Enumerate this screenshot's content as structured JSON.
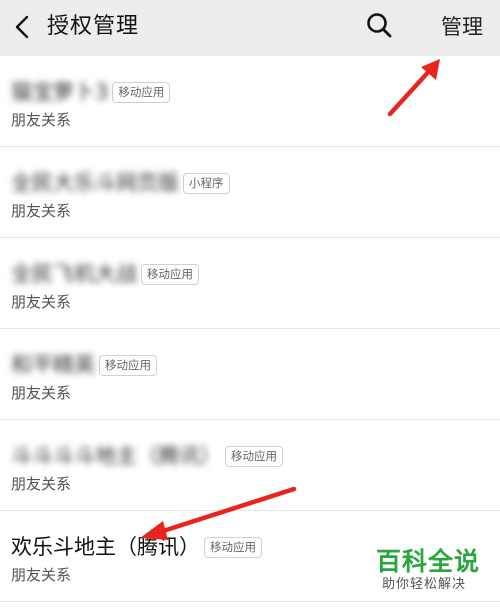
{
  "header": {
    "title": "授权管理",
    "manage_label": "管理"
  },
  "items": [
    {
      "name": "猫宝萝卜3",
      "badge": "移动应用",
      "relation": "朋友关系",
      "blurred": true
    },
    {
      "name": "全民大乐斗网页版",
      "badge": "小程序",
      "relation": "朋友关系",
      "blurred": true
    },
    {
      "name": "全民飞机大战",
      "badge": "移动应用",
      "relation": "朋友关系",
      "blurred": true
    },
    {
      "name": "和平精英",
      "badge": "移动应用",
      "relation": "朋友关系",
      "blurred": true
    },
    {
      "name": "斗斗斗斗地主（腾讯）",
      "badge": "移动应用",
      "relation": "朋友关系",
      "blurred": true
    },
    {
      "name": "欢乐斗地主（腾讯）",
      "badge": "移动应用",
      "relation": "朋友关系",
      "blurred": false
    }
  ],
  "watermark": {
    "main": "百科全说",
    "sub": "助你轻松解决"
  },
  "colors": {
    "header_bg": "#ededed",
    "arrow": "#e8241c",
    "watermark_green": "#2aa63f"
  }
}
